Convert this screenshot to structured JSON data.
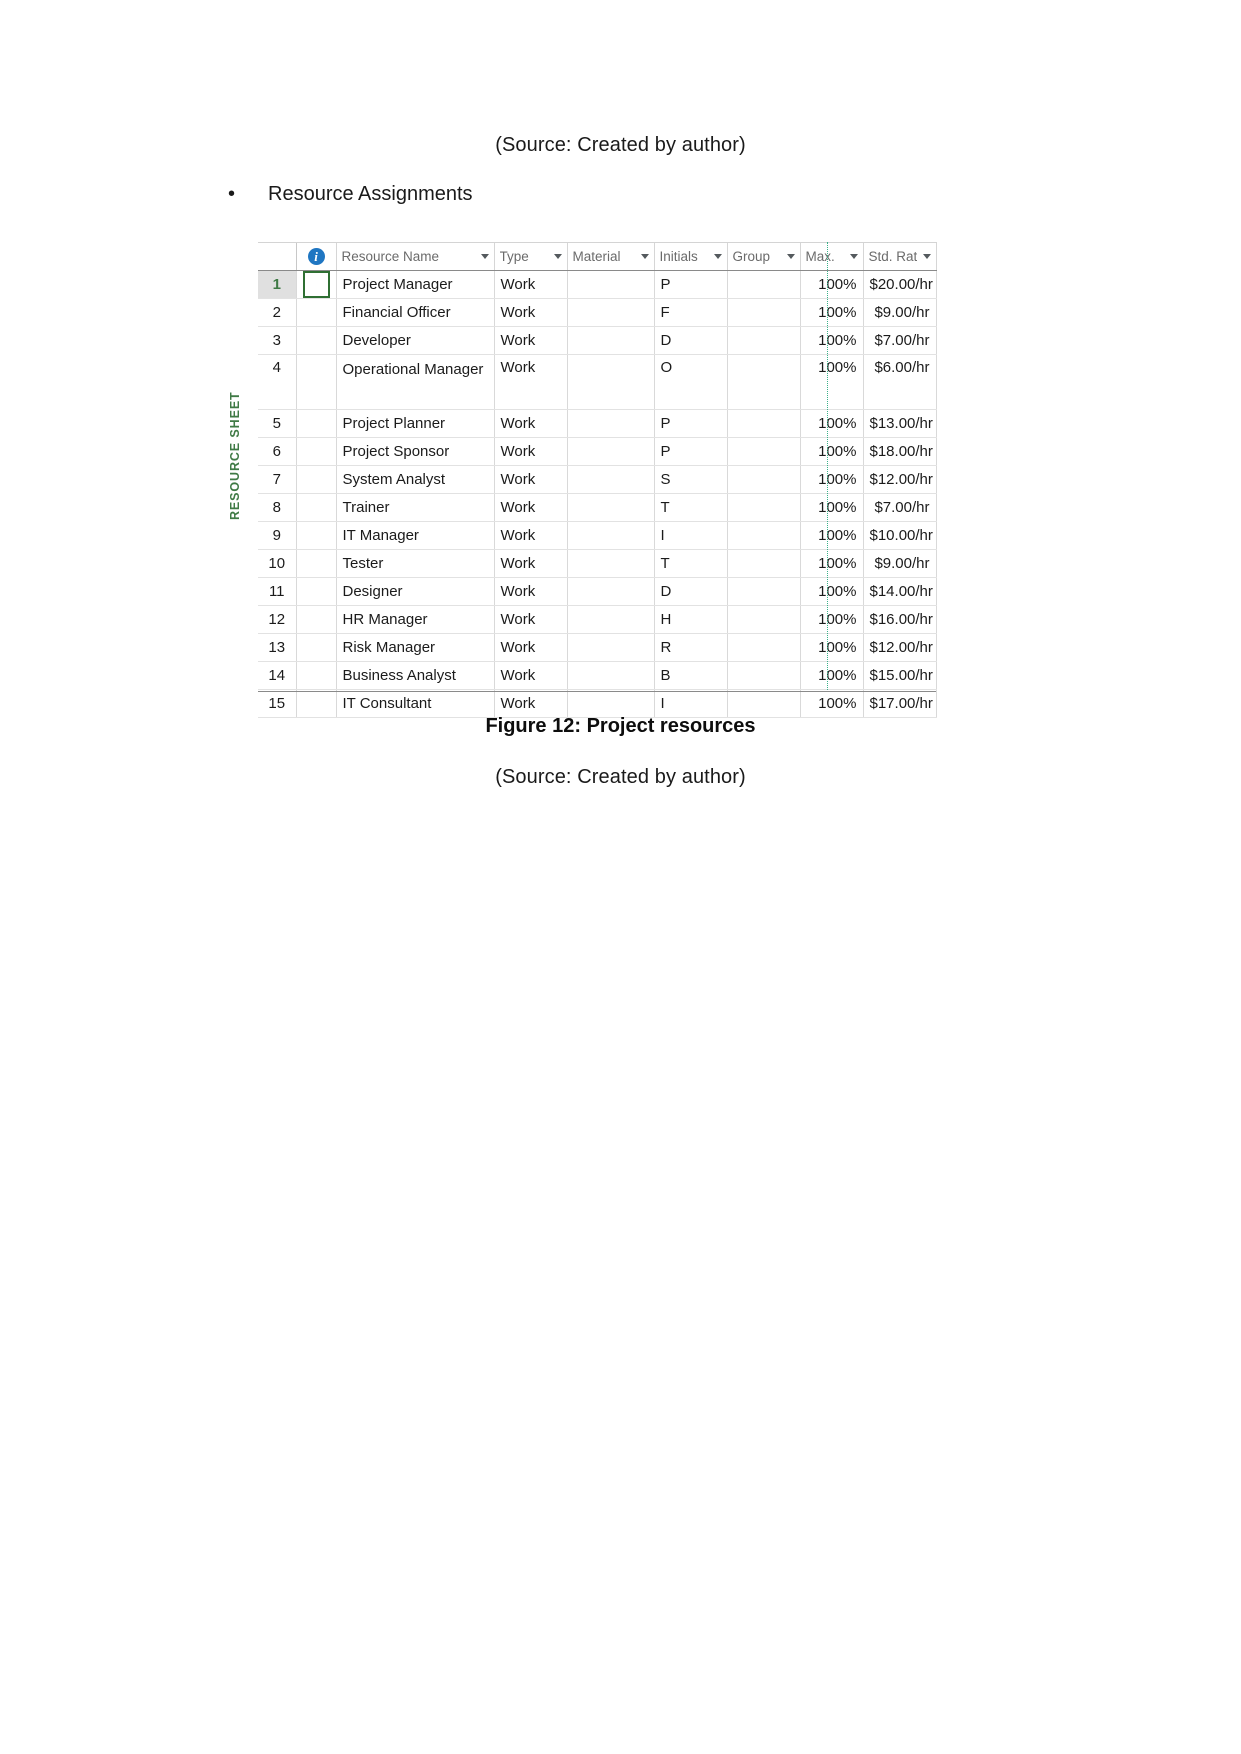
{
  "document": {
    "source_note_top": "(Source: Created by author)",
    "bullet_marker": "•",
    "bullet_text": "Resource Assignments",
    "figure_caption": "Figure 12: Project resources",
    "source_note_bottom": "(Source: Created by author)"
  },
  "sheet": {
    "view_label": "RESOURCE SHEET",
    "indicator_icon": "info-icon",
    "indicator_glyph": "i",
    "columns": [
      {
        "key": "id",
        "label": ""
      },
      {
        "key": "indicator",
        "label": ""
      },
      {
        "key": "resource_name",
        "label": "Resource Name",
        "filter": true
      },
      {
        "key": "type",
        "label": "Type",
        "filter": true
      },
      {
        "key": "material",
        "label": "Material",
        "filter": true
      },
      {
        "key": "initials",
        "label": "Initials",
        "filter": true
      },
      {
        "key": "group",
        "label": "Group",
        "filter": true
      },
      {
        "key": "max",
        "label": "Max.",
        "filter": true
      },
      {
        "key": "std_rate",
        "label": "Std. Rate",
        "filter": true
      }
    ],
    "rows": [
      {
        "id": "1",
        "resource_name": "Project Manager",
        "type": "Work",
        "material": "",
        "initials": "P",
        "group": "",
        "max": "100%",
        "std_rate": "$20.00/hr",
        "selected": true
      },
      {
        "id": "2",
        "resource_name": "Financial Officer",
        "type": "Work",
        "material": "",
        "initials": "F",
        "group": "",
        "max": "100%",
        "std_rate": "$9.00/hr"
      },
      {
        "id": "3",
        "resource_name": "Developer",
        "type": "Work",
        "material": "",
        "initials": "D",
        "group": "",
        "max": "100%",
        "std_rate": "$7.00/hr"
      },
      {
        "id": "4",
        "resource_name": "Operational Manager",
        "type": "Work",
        "material": "",
        "initials": "O",
        "group": "",
        "max": "100%",
        "std_rate": "$6.00/hr",
        "tall": true
      },
      {
        "id": "5",
        "resource_name": "Project Planner",
        "type": "Work",
        "material": "",
        "initials": "P",
        "group": "",
        "max": "100%",
        "std_rate": "$13.00/hr"
      },
      {
        "id": "6",
        "resource_name": "Project Sponsor",
        "type": "Work",
        "material": "",
        "initials": "P",
        "group": "",
        "max": "100%",
        "std_rate": "$18.00/hr"
      },
      {
        "id": "7",
        "resource_name": "System Analyst",
        "type": "Work",
        "material": "",
        "initials": "S",
        "group": "",
        "max": "100%",
        "std_rate": "$12.00/hr"
      },
      {
        "id": "8",
        "resource_name": "Trainer",
        "type": "Work",
        "material": "",
        "initials": "T",
        "group": "",
        "max": "100%",
        "std_rate": "$7.00/hr"
      },
      {
        "id": "9",
        "resource_name": "IT Manager",
        "type": "Work",
        "material": "",
        "initials": "I",
        "group": "",
        "max": "100%",
        "std_rate": "$10.00/hr"
      },
      {
        "id": "10",
        "resource_name": "Tester",
        "type": "Work",
        "material": "",
        "initials": "T",
        "group": "",
        "max": "100%",
        "std_rate": "$9.00/hr"
      },
      {
        "id": "11",
        "resource_name": "Designer",
        "type": "Work",
        "material": "",
        "initials": "D",
        "group": "",
        "max": "100%",
        "std_rate": "$14.00/hr"
      },
      {
        "id": "12",
        "resource_name": "HR Manager",
        "type": "Work",
        "material": "",
        "initials": "H",
        "group": "",
        "max": "100%",
        "std_rate": "$16.00/hr"
      },
      {
        "id": "13",
        "resource_name": "Risk Manager",
        "type": "Work",
        "material": "",
        "initials": "R",
        "group": "",
        "max": "100%",
        "std_rate": "$12.00/hr"
      },
      {
        "id": "14",
        "resource_name": "Business Analyst",
        "type": "Work",
        "material": "",
        "initials": "B",
        "group": "",
        "max": "100%",
        "std_rate": "$15.00/hr"
      },
      {
        "id": "15",
        "resource_name": "IT Consultant",
        "type": "Work",
        "material": "",
        "initials": "I",
        "group": "",
        "max": "100%",
        "std_rate": "$17.00/hr"
      }
    ]
  },
  "colors": {
    "selection_green": "#2f6f33",
    "view_label_green": "#3f7a45",
    "info_blue": "#1f76c2",
    "page_break_teal": "#39b089"
  }
}
